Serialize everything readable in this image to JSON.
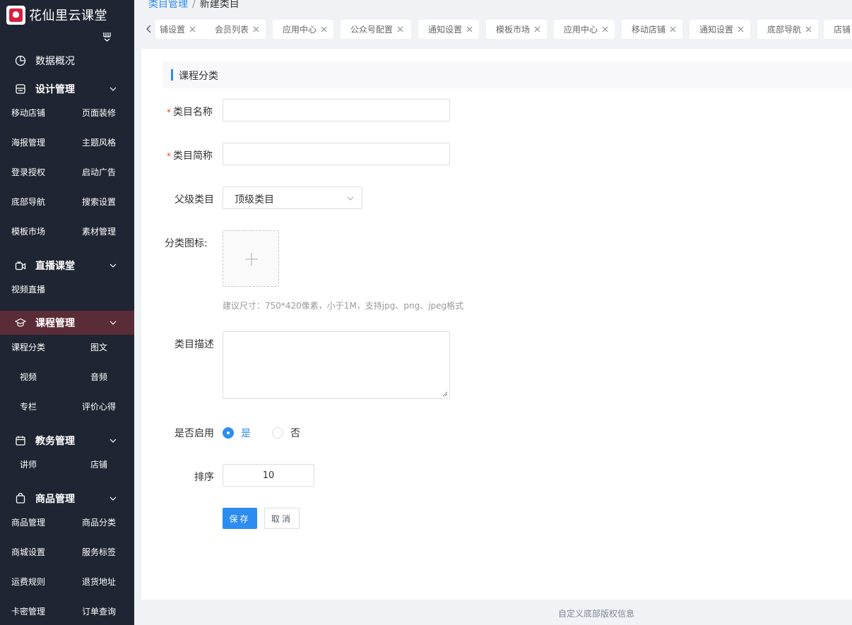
{
  "app": {
    "title": "花仙里云课堂"
  },
  "breadcrumb": {
    "parent": "类目管理",
    "separator": "/",
    "current": "新建类目"
  },
  "sidebar": {
    "overview": "数据概况",
    "groups": [
      {
        "label": "设计管理",
        "items": [
          "移动店铺",
          "页面装修",
          "海报管理",
          "主题风格",
          "登录授权",
          "启动广告",
          "底部导航",
          "搜索设置",
          "模板市场",
          "素材管理"
        ]
      },
      {
        "label": "直播课堂",
        "items": [
          "视频直播"
        ]
      },
      {
        "label": "课程管理",
        "items": [
          "课程分类",
          "图文",
          "视频",
          "音频",
          "专栏",
          "评价心得"
        ]
      },
      {
        "label": "教务管理",
        "items": [
          "讲师",
          "店铺"
        ]
      },
      {
        "label": "商品管理",
        "items": [
          "商品管理",
          "商品分类",
          "商城设置",
          "服务标签",
          "运费规则",
          "退货地址",
          "卡密管理",
          "订单查询"
        ]
      }
    ]
  },
  "tabs": [
    "铺设置",
    "会员列表",
    "应用中心",
    "公众号配置",
    "通知设置",
    "模板市场",
    "应用中心",
    "移动店铺",
    "通知设置",
    "底部导航",
    "店铺"
  ],
  "form": {
    "section_title": "课程分类",
    "name_label": "类目名称",
    "short_label": "类目简称",
    "parent_label": "父级类目",
    "parent_value": "顶级类目",
    "icon_label": "分类图标:",
    "icon_hint": "建议尺寸：750*420像素，小于1M，支持jpg、png、jpeg格式",
    "desc_label": "类目描述",
    "enable_label": "是否启用",
    "enable_yes": "是",
    "enable_no": "否",
    "enabled": true,
    "sort_label": "排序",
    "sort_value": "10",
    "required_mark": "*",
    "save": "保存",
    "cancel": "取消"
  },
  "footer": {
    "text": "自定义底部版权信息"
  },
  "colors": {
    "primary": "#2d8cf0",
    "sidebar_bg": "#1f2532",
    "sidebar_active": "#5a2c37",
    "required": "#ed4014"
  }
}
